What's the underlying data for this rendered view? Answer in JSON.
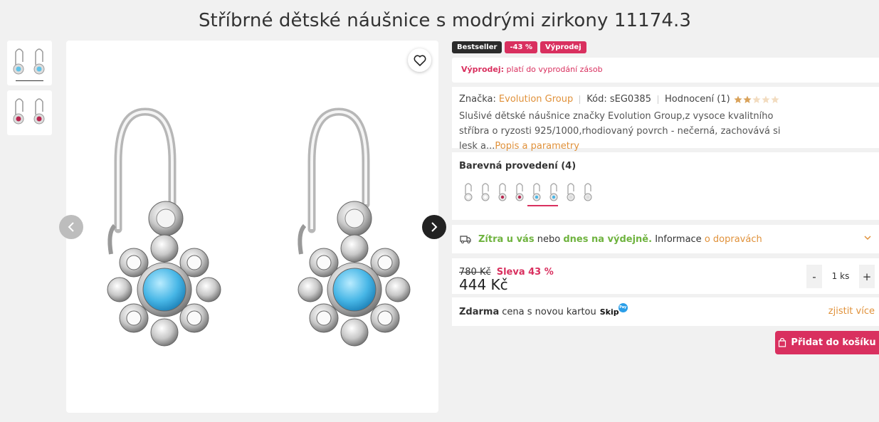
{
  "product": {
    "title": "Stříbrné dětské náušnice s modrými zirkony 11174.3"
  },
  "badges": [
    "Bestseller",
    "-43 %",
    "Výprodej"
  ],
  "sale": {
    "label": "Výprodej:",
    "text": "platí do vyprodání zásob"
  },
  "info": {
    "brand_label": "Značka:",
    "brand": "Evolution Group",
    "code": "Kód: sEG0385",
    "rating_label": "Hodnocení (1)",
    "rating": 2,
    "rating_max": 5,
    "description": "Slušivé dětské náušnice značky Evolution Group,z vysoce kvalitního stříbra o ryzosti 925/1000,rhodiovaný povrch - nečerná, zachovává si lesk a...",
    "more_link": "Popis a parametry"
  },
  "variants": {
    "title": "Barevná provedení (4)"
  },
  "delivery": {
    "today": "Zítra u vás",
    "or": "nebo",
    "pickup": "dnes na výdejně.",
    "info": "Informace",
    "link": "o dopravách"
  },
  "price": {
    "old": "780 Kč",
    "discount": "Sleva 43 %",
    "current": "444 Kč",
    "qty": "1 ks",
    "minus": "-",
    "plus": "+"
  },
  "skip": {
    "bold": "Zdarma",
    "text": "cena s novou kartou",
    "logo": "Skip",
    "logo_badge": "Pay",
    "more": "zjistit více"
  },
  "cart": {
    "label": "Přidat do košíku"
  },
  "colors": {
    "accent": "#d9305f",
    "link": "#e0913a",
    "green": "#6fb33f",
    "star": "#d9a25a"
  }
}
